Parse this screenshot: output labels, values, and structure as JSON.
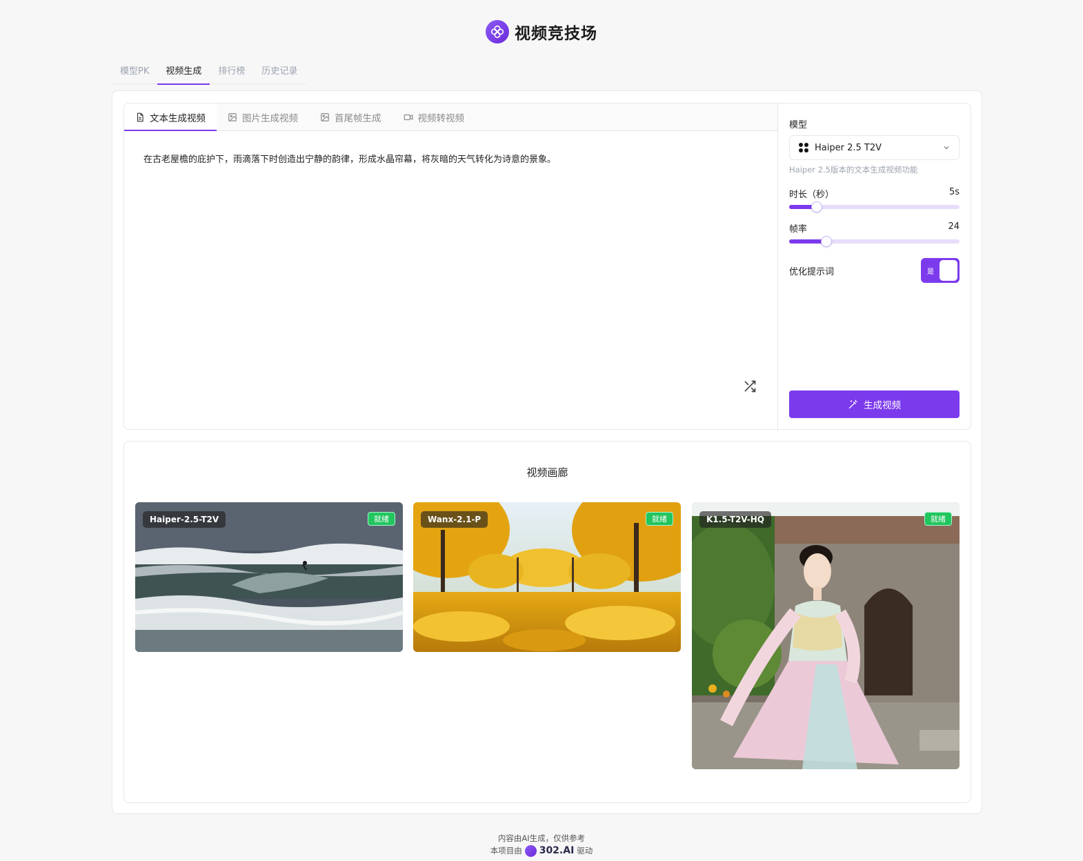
{
  "app": {
    "title": "视频竞技场"
  },
  "nav": {
    "tabs": [
      {
        "label": "模型PK",
        "active": false
      },
      {
        "label": "视频生成",
        "active": true
      },
      {
        "label": "排行榜",
        "active": false
      },
      {
        "label": "历史记录",
        "active": false
      }
    ]
  },
  "editor": {
    "tabs": [
      {
        "label": "文本生成视频",
        "icon": "document-icon",
        "active": true
      },
      {
        "label": "图片生成视频",
        "icon": "image-icon",
        "active": false
      },
      {
        "label": "首尾帧生成",
        "icon": "image-icon",
        "active": false
      },
      {
        "label": "视频转视频",
        "icon": "video-icon",
        "active": false
      }
    ],
    "prompt": "在古老屋檐的庇护下，雨滴落下时创造出宁静的韵律，形成水晶帘幕，将灰暗的天气转化为诗意的景象。"
  },
  "settings": {
    "model_label": "模型",
    "model_value": "Haiper 2.5 T2V",
    "model_desc": "Haiper 2.5版本的文本生成视频功能",
    "duration_label": "时长（秒）",
    "duration_value": "5s",
    "duration_fraction": 0.16,
    "fps_label": "帧率",
    "fps_value": "24",
    "fps_fraction": 0.22,
    "optimize_label": "优化提示词",
    "optimize_toggle_text": "是",
    "optimize_on": true,
    "generate_label": "生成视频"
  },
  "gallery": {
    "title": "视频画廊",
    "items": [
      {
        "model": "Haiper-2.5-T2V",
        "status": "就绪",
        "scene": "ocean-surf"
      },
      {
        "model": "Wanx-2.1-P",
        "status": "就绪",
        "scene": "ginkgo-forest"
      },
      {
        "model": "K1.5-T2V-HQ",
        "status": "就绪",
        "scene": "woman-in-hanfu-courtyard"
      }
    ]
  },
  "footer": {
    "line1": "内容由AI生成，仅供参考",
    "prefix": "本项目由",
    "brand": "302.AI",
    "suffix": "驱动"
  },
  "colors": {
    "accent": "#7c3aed",
    "status": "#22c55e"
  }
}
